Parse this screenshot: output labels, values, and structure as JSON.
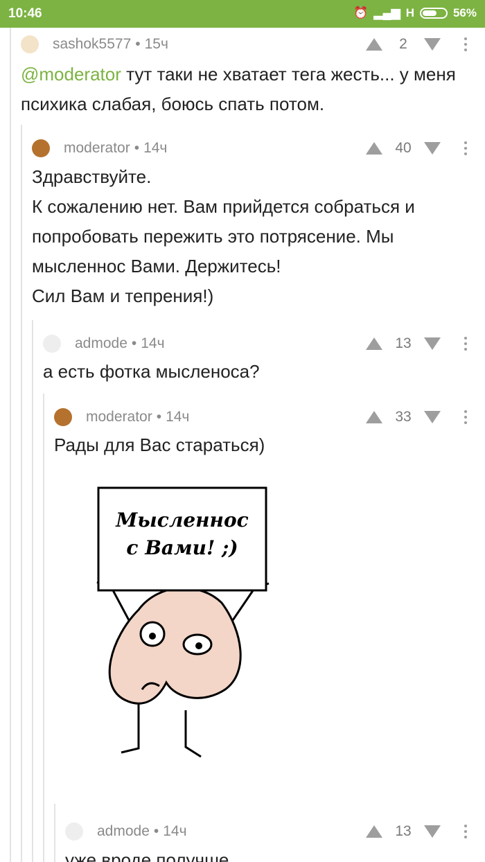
{
  "status_bar": {
    "time": "10:46",
    "network": "H",
    "battery": "56%"
  },
  "colors": {
    "accent": "#7cb342",
    "muted": "#8a8a8a"
  },
  "comments": [
    {
      "user": "sashok5577",
      "age": "15ч",
      "score": "2",
      "mention": "@moderator",
      "text": " тут таки не хватает тега жесть... у меня психика слабая, боюсь спать потом."
    },
    {
      "user": "moderator",
      "age": "14ч",
      "score": "40",
      "text": "Здравствуйте.\nК сожалению нет. Вам прийдется собраться и попробовать пережить это потрясение. Мы мысленнос Вами. Держитесь!\nСил Вам и тепрения!)"
    },
    {
      "user": "admode",
      "age": "14ч",
      "score": "13",
      "text": "а есть фотка мысленоса?"
    },
    {
      "user": "moderator",
      "age": "14ч",
      "score": "33",
      "text": "Рады для Вас стараться)",
      "image": {
        "sign_line1": "Мысленнос",
        "sign_line2": "с Вами! ;)"
      }
    },
    {
      "user": "admode",
      "age": "14ч",
      "score": "13",
      "text": "уже вроде получше"
    }
  ]
}
